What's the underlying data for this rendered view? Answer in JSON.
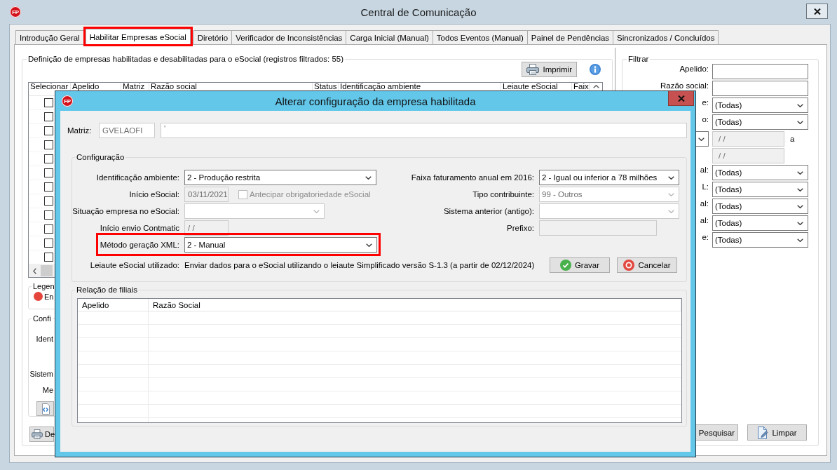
{
  "window": {
    "logo": "FP",
    "title": "Central de Comunicação"
  },
  "tabs": [
    {
      "label": "Introdução Geral",
      "selected": false,
      "highlighted": false
    },
    {
      "label": "Habilitar Empresas eSocial",
      "selected": true,
      "highlighted": true
    },
    {
      "label": "Diretório",
      "selected": false,
      "highlighted": false
    },
    {
      "label": "Verificador de Inconsistências",
      "selected": false,
      "highlighted": false
    },
    {
      "label": "Carga Inicial (Manual)",
      "selected": false,
      "highlighted": false
    },
    {
      "label": "Todos Eventos (Manual)",
      "selected": false,
      "highlighted": false
    },
    {
      "label": "Painel de Pendências",
      "selected": false,
      "highlighted": false
    },
    {
      "label": "Sincronizados / Concluídos",
      "selected": false,
      "highlighted": false
    }
  ],
  "companies_panel": {
    "title": "Definição de empresas habilitadas e desabilitadas para o eSocial (registros filtrados: 55)",
    "print_button": "Imprimir",
    "table": {
      "columns": [
        "Selecionar",
        "Apelido",
        "Matriz",
        "Razão social",
        "Status",
        "Identificação ambiente",
        "Leiaute eSocial",
        "Faix"
      ],
      "rows": [
        {
          "checked": false
        },
        {
          "checked": false
        },
        {
          "checked": false
        },
        {
          "checked": false
        },
        {
          "checked": false
        },
        {
          "checked": false
        },
        {
          "checked": false
        },
        {
          "checked": false
        },
        {
          "checked": false
        },
        {
          "checked": false
        },
        {
          "checked": false
        },
        {
          "checked": false
        }
      ]
    },
    "legend": {
      "title": "Legen",
      "items": [
        {
          "label": "En",
          "color": "#e5463c"
        }
      ]
    },
    "config": {
      "title": "Confi",
      "labels": [
        "Ident",
        "Sistem",
        "Me"
      ]
    },
    "bottom_button": "De"
  },
  "filter": {
    "title": "Filtrar",
    "fields": [
      {
        "kind": "text",
        "label": "Apelido:",
        "disabled": false
      },
      {
        "kind": "text",
        "label": "Razão social:",
        "disabled": false
      },
      {
        "kind": "select",
        "label": "e:",
        "value": "(Todas)",
        "disabled": false
      },
      {
        "kind": "select",
        "label": "o:",
        "value": "(Todas)",
        "disabled": false
      },
      {
        "kind": "period",
        "value": "/ /",
        "suffix": "a",
        "disabled": true
      },
      {
        "kind": "date",
        "value": "/ /",
        "disabled": true
      },
      {
        "kind": "select",
        "label": "al:",
        "value": "(Todas)",
        "disabled": false
      },
      {
        "kind": "select",
        "label": "L:",
        "value": "(Todas)",
        "disabled": false
      },
      {
        "kind": "select",
        "label": "al:",
        "value": "(Todas)",
        "disabled": false
      },
      {
        "kind": "select",
        "label": "al:",
        "value": "(Todas)",
        "disabled": false
      },
      {
        "kind": "select",
        "label": "e:",
        "value": "(Todas)",
        "disabled": false
      }
    ],
    "buttons": [
      {
        "kind": "search",
        "label": "Pesquisar"
      },
      {
        "kind": "clear",
        "label": "Limpar"
      }
    ]
  },
  "dialog": {
    "logo": "FP",
    "title": "Alterar configuração da empresa habilitada",
    "matrix": {
      "label": "Matriz:",
      "code": {
        "value": "GVELAOFI",
        "disabled": true
      },
      "name": {
        "value": "'",
        "disabled": true
      }
    },
    "configuration": {
      "title": "Configuração",
      "left_fields": [
        {
          "kind": "select",
          "label": "Identificação ambiente:",
          "value": "2 - Produção restrita",
          "disabled": false,
          "highlighted": false
        },
        {
          "kind": "date",
          "label": "Início eSocial:",
          "value": "03/11/2021",
          "disabled": true,
          "highlighted": false,
          "checkbox": {
            "label": "Antecipar obrigatoriedade eSocial",
            "checked": false,
            "disabled": true
          }
        },
        {
          "kind": "select",
          "label": "Situação empresa no eSocial:",
          "disabled": true,
          "highlighted": false
        },
        {
          "kind": "date",
          "label": "Início envio Contmatic",
          "value": "/ /",
          "disabled": true,
          "highlighted": false
        },
        {
          "kind": "select",
          "label": "Método geração XML:",
          "value": "2 - Manual",
          "disabled": false,
          "highlighted": true
        }
      ],
      "right_fields": [
        {
          "kind": "select",
          "label": "Faixa faturamento anual em 2016:",
          "value": "2 - Igual ou inferior a 78 milhões",
          "disabled": false,
          "highlighted": false
        },
        {
          "kind": "select",
          "label": "Tipo contribuinte:",
          "value": "99 - Outros",
          "disabled": true,
          "highlighted": false
        },
        {
          "kind": "select",
          "label": "Sistema anterior (antigo):",
          "disabled": true,
          "highlighted": false
        },
        {
          "kind": "text",
          "label": "Prefixo:",
          "disabled": true,
          "highlighted": false
        }
      ],
      "layout_label": "Leiaute eSocial utilizado:",
      "layout_text": "Enviar dados para o eSocial utilizando o leiaute Simplificado versão S-1.3 (a partir de 02/12/2024)",
      "buttons": [
        {
          "kind": "save",
          "label": "Gravar"
        },
        {
          "kind": "cancel",
          "label": "Cancelar"
        }
      ]
    },
    "branches": {
      "title": "Relação de filiais",
      "columns": [
        "Apelido",
        "Razão Social"
      ]
    }
  }
}
